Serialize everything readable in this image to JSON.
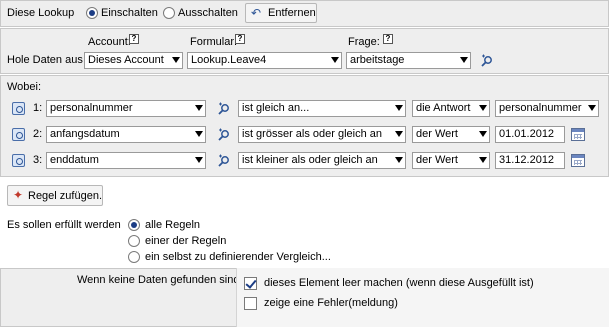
{
  "lookup": {
    "label": "Diese Lookup",
    "on_label": "Einschalten",
    "off_label": "Ausschalten",
    "remove_label": "Entfernen",
    "state": "on"
  },
  "source": {
    "label": "Hole Daten aus",
    "account_label": "Account:",
    "form_label": "Formular:",
    "question_label": "Frage:",
    "help_glyph": "?",
    "account_value": "Dieses Account",
    "form_value": "Lookup.Leave4",
    "question_value": "arbeitstage"
  },
  "wobei": {
    "label": "Wobei:",
    "rows": [
      {
        "num": "1:",
        "field": "personalnummer",
        "operator": "ist gleich an...",
        "type": "die Antwort",
        "value": "personalnummer",
        "value_kind": "select"
      },
      {
        "num": "2:",
        "field": "anfangsdatum",
        "operator": "ist grösser als oder gleich an",
        "type": "der Wert",
        "value": "01.01.2012",
        "value_kind": "date"
      },
      {
        "num": "3:",
        "field": "enddatum",
        "operator": "ist kleiner als oder gleich an",
        "type": "der Wert",
        "value": "31.12.2012",
        "value_kind": "date"
      }
    ],
    "add_rule_label": "Regel zufügen."
  },
  "match": {
    "label": "Es sollen erfüllt werden",
    "options": [
      "alle Regeln",
      "einer der Regeln",
      "ein selbst zu definierender Vergleich..."
    ],
    "selected": 0
  },
  "nodata": {
    "label": "Wenn keine Daten gefunden sind:",
    "options": [
      {
        "label": "dieses Element leer machen (wenn diese Ausgefüllt ist)",
        "checked": true
      },
      {
        "label": "zeige eine Fehler(meldung)",
        "checked": false
      }
    ]
  },
  "colors": {
    "panel": "#eeeeee",
    "accent": "#1c3d85",
    "border": "#c8c8c8"
  }
}
